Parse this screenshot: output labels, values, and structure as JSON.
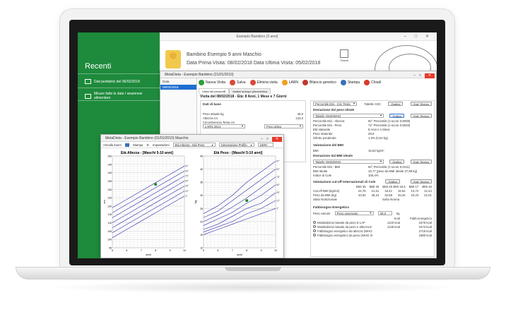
{
  "app": {
    "window_title": "Esempio Bambino (3 anni)",
    "window_controls": "–  □  ✕"
  },
  "sidebar": {
    "title": "Recenti",
    "items": [
      {
        "label": "Dati pediatrici del 06/02/2018",
        "icon": "grid-icon"
      },
      {
        "label": "Misure fatte le date / anamnesi alimentare",
        "icon": "cards-icon"
      }
    ]
  },
  "patient": {
    "name_line": "Bambino Esempio   9 anni   Maschio",
    "dates_line": "Data Prima Visita: 08/02/2018   Data Ultima Visita: 05/02/2018",
    "close_label": "Chiudi"
  },
  "meta_window": {
    "title": "MetaDieta - Esempio Bambino (21/01/2010)",
    "left_header": "Data",
    "left_selected": "08/02/2018",
    "toolbar": [
      {
        "label": "Nuova Visita",
        "color": "#2e9e3e"
      },
      {
        "label": "Salva",
        "color": "#d94a3a"
      },
      {
        "label": "Elimina visita",
        "color": "#d94a3a"
      },
      {
        "label": "LARN",
        "color": "#f0a020"
      },
      {
        "label": "Bilancio genetico",
        "color": "#c2372b"
      },
      {
        "label": "Stampa",
        "color": "#3a6fb8"
      },
      {
        "label": "Chiudi",
        "color": "#d93a2a"
      }
    ],
    "tabs": [
      "Visita del percentili",
      "Analisi antropo plicometrica"
    ],
    "visit_title": "Visita del 08/02/2018 - Età: 8 Anni, 1 Mese e 7 Giorni",
    "left_pane": {
      "section": "Dati di base",
      "rows": [
        {
          "label": "Peso attuale kg",
          "value": "28,0"
        },
        {
          "label": "Altezza cm",
          "value": "133,0"
        },
        {
          "label": "Circonferenza Testa cm",
          "value": ""
        }
      ],
      "larn_select": "LARN 2014",
      "peso_select": "Peso attivo",
      "link": "Modalità BMI Nuovo"
    },
    "right_pane": {
      "top_select": "Percentile Età - Circ Testa",
      "top_select2": "Tabelle CDC",
      "btn_grafico": "Grafico",
      "btn_storico": "Graf. Storico",
      "sec1": "Deviazione dal peso ideale",
      "sec1_select": "Tabelle OMS/WHO",
      "sec1_rows": [
        {
          "label": "Percentile Età - Altezza",
          "value": "82° Percentile (z-score 0,9008)"
        },
        {
          "label": "Percentile Età - Peso",
          "value": "72° Percentile (z-score 0,5833)"
        },
        {
          "label": "Età staturale",
          "value": "8 Anni e 1 Mese"
        },
        {
          "label": "Peso staturale",
          "value": "28,6"
        },
        {
          "label": "Difetto ponderale",
          "value": "1,0% (0,54 kg)"
        }
      ],
      "sec2": "Valutazione del BMI",
      "bmi_label": "BMI",
      "bmi_value": "15,83 kg/m²",
      "sec3": "Deviazione dal BMI ideale",
      "sec3_select": "Tabelle OMS/WHO",
      "sec3_rows": [
        {
          "label": "Percentile Età - BMI",
          "value": "50° Percentile (z-score 0,0411)"
        },
        {
          "label": "BMI ideale",
          "value": "15,77 (peso da BMI ideale 27,89 kg)"
        },
        {
          "label": "Indice di Cole",
          "value": "100,4%"
        }
      ],
      "sec4": "Valutazione cut-off Internazionali di Cole",
      "cole_headers": [
        "BMI 35",
        "BMI 30",
        "BMI 25",
        "BMI 18.5",
        "BMI 17",
        "BMI 16"
      ],
      "cole_rows": [
        {
          "label": "Cut-off BMI (kg/m2)",
          "values": [
            "24,78",
            "21,61",
            "18,41",
            "15,54",
            "13,72",
            "12,44"
          ]
        },
        {
          "label": "Peso da BMI (kg)",
          "values": [
            "43,82",
            "38,24",
            "32,58",
            "25,34",
            "23,23",
            "22,01"
          ]
        }
      ],
      "cole_status_label": "Stato Nutrizionale",
      "cole_status": "Sotto Norma",
      "sec5": "Fabbisogno Energetico",
      "fab_select_label": "Peso calcolo",
      "fab_select": "Peso osservato",
      "fab_value": "28,0",
      "fab_unit": "kg",
      "fab_col1": "Kcal",
      "fab_col2": "Fabb.energetico",
      "fab_rows": [
        {
          "label": "Metabolismo basale da peso E LAF",
          "v1": "1140 kcal",
          "v2": "1675 kcal"
        },
        {
          "label": "Metabolismo basale da peso e altezza E LAF",
          "v1": "1139 kcal",
          "v2": "1673 kcal"
        },
        {
          "label": "Fabbisogno energetico da altezza (WHO 1985)",
          "v1": "",
          "v2": "2718 kcal"
        },
        {
          "label": "Fabbisogno energetico da peso (WHO 2001)",
          "v1": "",
          "v2": "1980 kcal"
        }
      ]
    }
  },
  "growth_window": {
    "title": "MetaDieta - Esempio Bambino (01/01/2010) Maschio",
    "toolbar": [
      "Annulla Zoom",
      "Stampa",
      "Impostazioni"
    ],
    "select1": "Età Altezza - Età Peso",
    "select2": "Generazione Profilo",
    "zoom": "100%",
    "chart1_title": "Età Altezza - [Maschi 5-10 anni]",
    "chart2_title": "Età Peso - [Maschi 5-10 anni]",
    "x_label": "anni",
    "chart1_ylabel": "cm",
    "chart2_ylabel": "kg"
  },
  "chart_data": [
    {
      "type": "line",
      "title": "Età Altezza - [Maschi 5-10 anni]",
      "xlabel": "anni",
      "ylabel": "cm",
      "x": [
        5,
        6,
        7,
        8,
        9,
        10
      ],
      "xlim": [
        5,
        10
      ],
      "ylim": [
        95,
        150
      ],
      "yticks": [
        95,
        100,
        105,
        110,
        115,
        120,
        125,
        130,
        135,
        140,
        145,
        150
      ],
      "series": [
        {
          "name": "3°",
          "values": [
            101,
            106,
            111,
            116,
            121,
            126
          ]
        },
        {
          "name": "10°",
          "values": [
            104,
            109,
            114,
            119,
            124,
            129
          ]
        },
        {
          "name": "25°",
          "values": [
            107,
            112,
            117,
            122,
            127,
            132
          ]
        },
        {
          "name": "50°",
          "values": [
            110,
            115,
            120,
            125,
            130,
            135
          ]
        },
        {
          "name": "75°",
          "values": [
            113,
            118,
            123,
            128,
            133,
            138
          ]
        },
        {
          "name": "90°",
          "values": [
            116,
            121,
            126,
            131,
            136,
            141
          ]
        },
        {
          "name": "97°",
          "values": [
            119,
            124,
            129,
            134,
            139,
            144
          ]
        }
      ],
      "point": {
        "x": 8,
        "y": 133
      },
      "color": "#2a2aa8",
      "grid": true
    },
    {
      "type": "line",
      "title": "Età Peso - [Maschi 5-10 anni]",
      "xlabel": "anni",
      "ylabel": "kg",
      "x": [
        5,
        6,
        7,
        8,
        9,
        10
      ],
      "xlim": [
        5,
        10
      ],
      "ylim": [
        10,
        45
      ],
      "yticks": [
        10,
        15,
        20,
        25,
        30,
        35,
        40,
        45
      ],
      "series": [
        {
          "name": "3°",
          "values": [
            15,
            17,
            19,
            21,
            23,
            25
          ]
        },
        {
          "name": "10°",
          "values": [
            16,
            18,
            20,
            23,
            25,
            28
          ]
        },
        {
          "name": "25°",
          "values": [
            17,
            19,
            22,
            25,
            27,
            31
          ]
        },
        {
          "name": "50°",
          "values": [
            18.5,
            21,
            23.5,
            27,
            30,
            34
          ]
        },
        {
          "name": "75°",
          "values": [
            20,
            22.5,
            25.5,
            29,
            33,
            37
          ]
        },
        {
          "name": "90°",
          "values": [
            21.5,
            24,
            28,
            32,
            36,
            40
          ]
        },
        {
          "name": "97°",
          "values": [
            23,
            26,
            30,
            35,
            39,
            43
          ]
        }
      ],
      "point": {
        "x": 8,
        "y": 28
      },
      "color": "#2a2aa8",
      "grid": true
    }
  ]
}
